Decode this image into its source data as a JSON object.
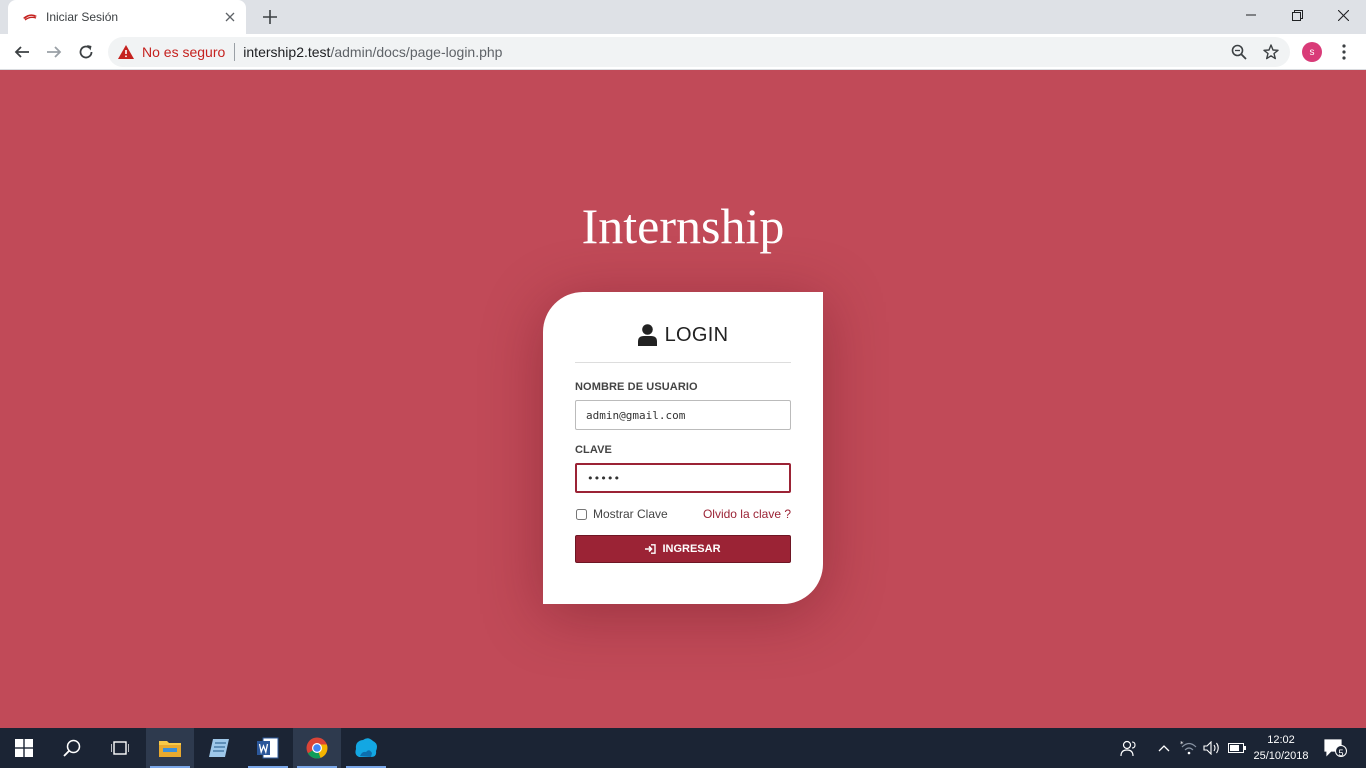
{
  "browser": {
    "tab_title": "Iniciar Sesión",
    "security_text": "No es seguro",
    "url_host": "intership2.test",
    "url_path": "/admin/docs/page-login.php",
    "profile_initial": "s"
  },
  "page": {
    "brand": "Internship",
    "login": {
      "title": "LOGIN",
      "username_label": "NOMBRE DE USUARIO",
      "username_value": "admin@gmail.com",
      "password_label": "CLAVE",
      "password_value": "•••••",
      "show_password_label": "Mostrar Clave",
      "forgot_link": "Olvido la clave ?",
      "submit_label": "INGRESAR"
    }
  },
  "colors": {
    "background": "#c14a58",
    "accent": "#9b2335",
    "taskbar": "#1b2434"
  },
  "taskbar": {
    "apps": [
      "start-icon",
      "search-icon",
      "task-view-icon",
      "file-explorer-icon",
      "notes-icon",
      "word-icon",
      "chrome-icon",
      "app-icon"
    ],
    "time": "12:02",
    "date": "25/10/2018",
    "notification_count": "5"
  }
}
